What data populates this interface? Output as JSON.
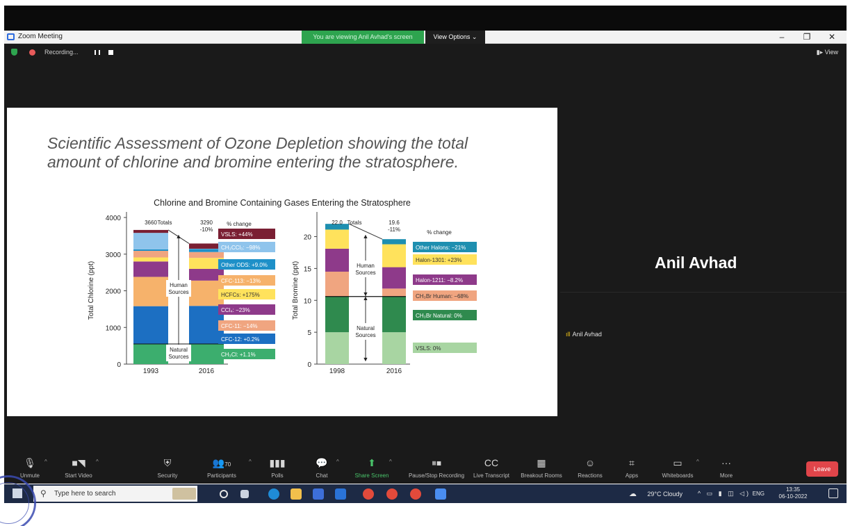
{
  "window": {
    "title": "Zoom Meeting",
    "viewing_banner": "You are viewing Anil Avhad's screen",
    "view_options": "View Options ⌄",
    "minimize": "–",
    "restore": "❐",
    "close": "✕"
  },
  "recording": {
    "label": "Recording...",
    "view_label": "View"
  },
  "slide": {
    "title_line1": "Scientific Assessment of Ozone Depletion showing the total",
    "title_line2": "amount of chlorine and bromine entering the stratosphere."
  },
  "chart_data": [
    {
      "type": "bar",
      "title": "Chlorine and Bromine Containing Gases Entering the Stratosphere",
      "ylabel": "Total Chlorine (ppt)",
      "ylim": [
        0,
        4000
      ],
      "yticks": [
        "0",
        "1000",
        "2000",
        "3000",
        "4000"
      ],
      "categories": [
        "1993",
        "2016"
      ],
      "stacked": true,
      "totals_label": "Totals",
      "totals": [
        "3660",
        "3290"
      ],
      "change_total": "-10%",
      "pct_header": "% change",
      "arrow_labels": {
        "human": [
          "Human",
          "Sources"
        ],
        "natural": [
          "Natural",
          "Sources"
        ]
      },
      "series": [
        {
          "name": "CH3Cl: +1.1%",
          "color": "#3cae6e",
          "values": [
            550,
            556
          ]
        },
        {
          "name": "CFC-12: +0.2%",
          "color": "#1c6fc2",
          "values": [
            1030,
            1032
          ]
        },
        {
          "name": "CFC-11: -14%",
          "color": "#f0a580",
          "values": [
            0,
            0
          ]
        },
        {
          "name": "CCl4: -23%",
          "color": "#8e3a8a",
          "values": [
            0,
            0
          ]
        },
        {
          "name": "HCFCs: +175%",
          "color": "#ffe25c",
          "values": [
            0,
            0
          ]
        },
        {
          "name": "CFC-113: -13%",
          "color": "#f6b26b",
          "values": [
            800,
            690
          ]
        },
        {
          "name": "Other ODS: +9.0%",
          "color": "#1e90c8",
          "values": [
            420,
            320
          ]
        },
        {
          "name": "CH3CCl3: -98%",
          "color": "#8fc4ec",
          "values": [
            0,
            0
          ]
        },
        {
          "name": "VSLS: +44%",
          "color": "#7a1f33",
          "values": [
            0,
            0
          ]
        }
      ],
      "stack_colors": [
        "#3cae6e",
        "#1c6fc2",
        "#f6b26b",
        "#8e3a8a",
        "#ffe25c",
        "#f0a580",
        "#1e90c8",
        "#8fc4ec",
        "#7a1f33"
      ],
      "stack_values": [
        [
          550,
          1030,
          800,
          420,
          110,
          180,
          40,
          450,
          80
        ],
        [
          556,
          1032,
          690,
          320,
          300,
          160,
          80,
          10,
          142
        ]
      ],
      "legend_labels": [
        "VSLS: +44%",
        "CH₃CCl₃: −98%",
        "Other ODS: +9.0%",
        "CFC-113: −13%",
        "HCFCs: +175%",
        "CCl₄: −23%",
        "CFC-11: −14%",
        "CFC-12: +0.2%",
        "CH₃Cl: +1.1%"
      ],
      "legend_colors": [
        "#7a1f33",
        "#8fc4ec",
        "#1e90c8",
        "#f6b26b",
        "#ffe25c",
        "#8e3a8a",
        "#f0a580",
        "#1c6fc2",
        "#3cae6e"
      ],
      "legend_text_colors": [
        "#ffffff",
        "#ffffff",
        "#ffffff",
        "#ffffff",
        "#333333",
        "#ffffff",
        "#ffffff",
        "#ffffff",
        "#ffffff"
      ]
    },
    {
      "type": "bar",
      "ylabel": "Total Bromine (ppt)",
      "ylim": [
        0,
        23
      ],
      "yticks": [
        "0",
        "5",
        "10",
        "15",
        "20"
      ],
      "categories": [
        "1998",
        "2016"
      ],
      "stacked": true,
      "totals_label": "Totals",
      "totals": [
        "22.0",
        "19.6"
      ],
      "change_total": "-11%",
      "pct_header": "% change",
      "arrow_labels": {
        "human": [
          "Human",
          "Sources"
        ],
        "natural": [
          "Natural",
          "Sources"
        ]
      },
      "stack_colors": [
        "#a8d5a2",
        "#2f8a4e",
        "#f0a580",
        "#8e3a8a",
        "#ffe25c",
        "#1e8fb0"
      ],
      "stack_values": [
        [
          5.0,
          5.6,
          3.9,
          3.6,
          3.0,
          0.9
        ],
        [
          5.0,
          5.6,
          1.25,
          3.35,
          3.6,
          0.8
        ]
      ],
      "legend_labels": [
        "Other Halons: −21%",
        "Halon-1301: +23%",
        "Halon-1211: −8.2%",
        "CH₃Br Human: −68%",
        "CH₃Br Natural: 0%",
        "VSLS: 0%"
      ],
      "legend_colors": [
        "#1e8fb0",
        "#ffe25c",
        "#8e3a8a",
        "#f0a580",
        "#2f8a4e",
        "#a8d5a2"
      ],
      "legend_text_colors": [
        "#ffffff",
        "#333333",
        "#ffffff",
        "#333333",
        "#ffffff",
        "#333333"
      ]
    }
  ],
  "speaker": {
    "name": "Anil Avhad",
    "small_name": "Anil Avhad"
  },
  "toolbar": {
    "unmute": "Unmute",
    "start_video": "Start Video",
    "security": "Security",
    "participants": "Participants",
    "participants_count": "70",
    "polls": "Polls",
    "chat": "Chat",
    "share_screen": "Share Screen",
    "pause_recording": "Pause/Stop Recording",
    "live_transcript": "Live Transcript",
    "breakout_rooms": "Breakout Rooms",
    "reactions": "Reactions",
    "apps": "Apps",
    "whiteboards": "Whiteboards",
    "more": "More",
    "leave": "Leave"
  },
  "taskbar": {
    "search_placeholder": "Type here to search",
    "weather": "29°C  Cloudy",
    "lang": "ENG",
    "time": "13:35",
    "date": "06-10-2022"
  },
  "colors": {
    "zoom_bg": "#1a1a1a",
    "banner_green": "#2ea44f",
    "leave_red": "#e0454a",
    "taskbar": "#1d2a45"
  }
}
